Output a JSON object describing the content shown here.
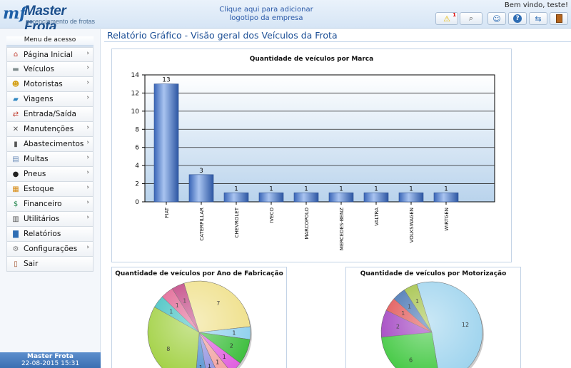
{
  "header": {
    "logo_mark": "mf",
    "logo_title": "Master Frota",
    "logo_subtitle": "gerenciamento de frotas",
    "company_logo_line1": "Clique aqui para adicionar",
    "company_logo_line2": "logotipo da empresa",
    "welcome": "Bem vindo, teste!",
    "alert_count": "1",
    "toolbar_icons": [
      "warning-icon",
      "search-icon",
      "user-icon",
      "help-icon",
      "sync-icon",
      "exit-door-icon"
    ]
  },
  "sidebar": {
    "title": "Menu de acesso",
    "items": [
      {
        "label": "Página Inicial",
        "icon": "home-icon",
        "glyph": "⌂",
        "color": "#c0392b",
        "arrow": true
      },
      {
        "label": "Veículos",
        "icon": "truck-icon",
        "glyph": "▬",
        "color": "#7f8c8d",
        "arrow": true
      },
      {
        "label": "Motoristas",
        "icon": "drivers-icon",
        "glyph": "☻",
        "color": "#d4a017",
        "arrow": true
      },
      {
        "label": "Viagens",
        "icon": "trip-truck-icon",
        "glyph": "▰",
        "color": "#2e86c1",
        "arrow": true
      },
      {
        "label": "Entrada/Saída",
        "icon": "entry-exit-icon",
        "glyph": "⇄",
        "color": "#c0392b",
        "arrow": false
      },
      {
        "label": "Manutenções",
        "icon": "tools-icon",
        "glyph": "✕",
        "color": "#555555",
        "arrow": true
      },
      {
        "label": "Abastecimentos",
        "icon": "fuel-pump-icon",
        "glyph": "▮",
        "color": "#555555",
        "arrow": true
      },
      {
        "label": "Multas",
        "icon": "fine-document-icon",
        "glyph": "▤",
        "color": "#6b8cb8",
        "arrow": true
      },
      {
        "label": "Pneus",
        "icon": "tire-icon",
        "glyph": "●",
        "color": "#222222",
        "arrow": true
      },
      {
        "label": "Estoque",
        "icon": "stock-box-icon",
        "glyph": "▦",
        "color": "#d68910",
        "arrow": true
      },
      {
        "label": "Financeiro",
        "icon": "dollar-icon",
        "glyph": "$",
        "color": "#1e8449",
        "arrow": true
      },
      {
        "label": "Utilitários",
        "icon": "utilities-icon",
        "glyph": "▥",
        "color": "#555555",
        "arrow": true
      },
      {
        "label": "Relatórios",
        "icon": "bar-chart-icon",
        "glyph": "▇",
        "color": "#2e6db4",
        "arrow": false
      },
      {
        "label": "Configurações",
        "icon": "gear-icon",
        "glyph": "⚙",
        "color": "#777777",
        "arrow": true
      },
      {
        "label": "Sair",
        "icon": "exit-door-icon",
        "glyph": "▯",
        "color": "#a0522d",
        "arrow": false
      }
    ],
    "footer_title": "Master Frota",
    "footer_datetime": "22-08-2015 15:31"
  },
  "main": {
    "page_title": "Relatório Gráfico - Visão geral dos Veículos da Frota"
  },
  "colors": {
    "bar": "#4f7fd0",
    "accent": "#1b4e95"
  },
  "chart_data": [
    {
      "type": "bar",
      "title": "Quantidade de veículos por Marca",
      "categories": [
        "FIAT",
        "CATERPILLAR",
        "CHEVROLET",
        "IVECO",
        "MARCOPOLO",
        "MERCEDES-BENZ",
        "VALTRA",
        "VOLKSWAGEN",
        "WIRTGEN"
      ],
      "values": [
        13,
        3,
        1,
        1,
        1,
        1,
        1,
        1,
        1
      ],
      "ylim": [
        0,
        14
      ],
      "yticks": [
        0,
        2,
        4,
        6,
        8,
        10,
        12,
        14
      ],
      "grid": true
    },
    {
      "type": "pie",
      "title": "Quantidade de veículos por Ano de Fabricação",
      "values": [
        7,
        1,
        2,
        1,
        1,
        1,
        1,
        8,
        1,
        1,
        1
      ],
      "colors": [
        "#efe08a",
        "#8fd0ee",
        "#3fbf3f",
        "#e060e0",
        "#f2a0a0",
        "#9090e0",
        "#5090d0",
        "#a0d040",
        "#40c0c0",
        "#e06090",
        "#c04080"
      ],
      "labels": [
        "7",
        "1",
        "2",
        "1",
        "1",
        "1",
        "1",
        "8",
        "1",
        "1",
        "1"
      ]
    },
    {
      "type": "pie",
      "title": "Quantidade de veículos por Motorização",
      "values": [
        12,
        6,
        2,
        1,
        1,
        1
      ],
      "colors": [
        "#9fd4ee",
        "#40c840",
        "#a040c0",
        "#e05050",
        "#4070b0",
        "#a0c040"
      ],
      "labels": [
        "12",
        "6",
        "2",
        "1",
        "1",
        "1"
      ]
    }
  ]
}
